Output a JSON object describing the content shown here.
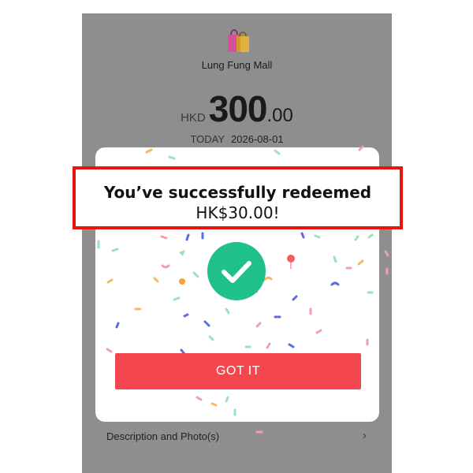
{
  "store": {
    "icon": "shopping-bags-icon",
    "name": "Lung Fung Mall"
  },
  "transaction": {
    "currency": "HKD",
    "amount_integer": "300",
    "amount_decimal": ".00",
    "date_label": "TODAY",
    "date": "2026-08-01"
  },
  "details": {
    "description_label": "Description and Photo(s)",
    "chevron": "›"
  },
  "dialog": {
    "message_line1": "You’ve successfully redeemed",
    "message_line2": "HK$30.00!",
    "icon": "success-check-icon",
    "button_label": "GOT IT"
  },
  "colors": {
    "highlight_border": "#e8150f",
    "success_green": "#1fc08a",
    "button_red": "#f4464e",
    "overlay_gray": "#8e8e8e"
  }
}
